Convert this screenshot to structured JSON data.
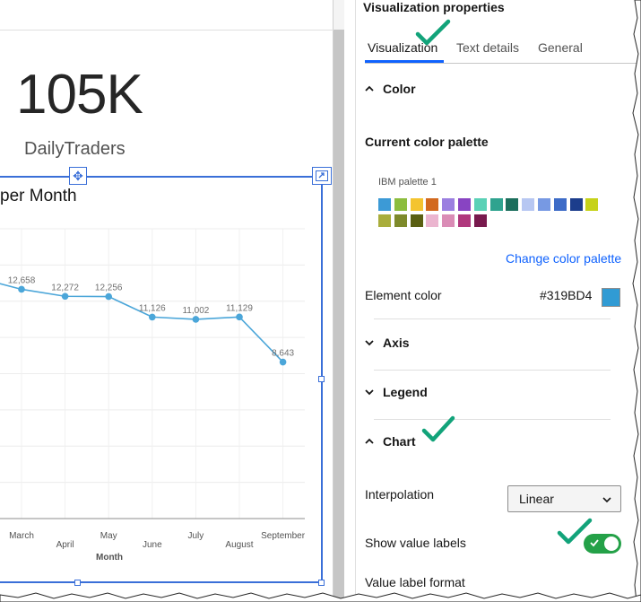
{
  "dashboard": {
    "kpi_value": "105K",
    "kpi_label": "DailyTraders",
    "chart_title": "per Month"
  },
  "chart_data": {
    "type": "line",
    "title": "per Month",
    "xlabel": "Month",
    "ylabel": "",
    "categories": [
      "March",
      "April",
      "May",
      "June",
      "July",
      "August",
      "September"
    ],
    "series": [
      {
        "values": [
          12658,
          12272,
          12256,
          11126,
          11002,
          11129,
          8643
        ],
        "labels": [
          "12,658",
          "12,272",
          "12,256",
          "11,126",
          "11,002",
          "11,129",
          "8,643"
        ]
      }
    ],
    "color": "#4ba6d9",
    "grid": true
  },
  "panel": {
    "title": "Visualization properties",
    "tabs": [
      "Visualization",
      "Text details",
      "General"
    ],
    "sections": {
      "color": "Color",
      "axis": "Axis",
      "legend": "Legend",
      "chart": "Chart"
    },
    "palette_heading": "Current color palette",
    "palette_name": "IBM palette 1",
    "palette_colors": [
      "#3c9ad6",
      "#8cbd3e",
      "#f4c430",
      "#d2691e",
      "#9b7fe0",
      "#8844c2",
      "#5ad1b6",
      "#2fa38f",
      "#1b6e5c",
      "#b7c7f2",
      "#7799e3",
      "#3d6bc7",
      "#1c3d8c",
      "#c6d219",
      "#a9ad3b",
      "#7e8a2b",
      "#5a5f12",
      "#ebb5cf",
      "#da8cb6",
      "#b0387d",
      "#78194d"
    ],
    "change_palette_label": "Change color palette",
    "element_color_label": "Element color",
    "element_color_value": "#319BD4",
    "interpolation_label": "Interpolation",
    "interpolation_value": "Linear",
    "show_value_labels_label": "Show value labels",
    "show_value_labels_on": true,
    "value_label_format_label": "Value label format"
  }
}
